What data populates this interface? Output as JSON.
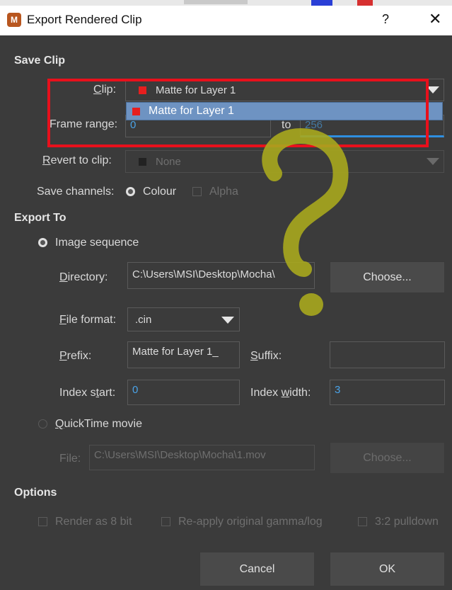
{
  "window": {
    "title": "Export Rendered Clip",
    "help": "?",
    "close": "✕",
    "app_icon": "M"
  },
  "save_clip": {
    "heading": "Save Clip",
    "clip_label": "Clip:",
    "clip_value": "Matte for Layer 1",
    "clip_option": "Matte for Layer 1",
    "frame_range_label": "Frame range:",
    "frame_from": "0",
    "frame_to_label": "to",
    "frame_to": "256",
    "revert_label": "Revert to clip:",
    "revert_value": "None",
    "channels_label": "Save channels:",
    "colour_label": "Colour",
    "alpha_label": "Alpha"
  },
  "export_to": {
    "heading": "Export To",
    "image_sequence_label": "Image sequence",
    "directory_label": "Directory:",
    "directory_value": "C:\\Users\\MSI\\Desktop\\Mocha\\",
    "choose_label": "Choose...",
    "file_format_label": "File format:",
    "file_format_value": ".cin",
    "prefix_label": "Prefix:",
    "prefix_value": "Matte for Layer 1_",
    "suffix_label": "Suffix:",
    "suffix_value": "",
    "index_start_label": "Index start:",
    "index_start_value": "0",
    "index_width_label": "Index width:",
    "index_width_value": "3",
    "quicktime_label": "QuickTime movie",
    "file_label": "File:",
    "file_value": "C:\\Users\\MSI\\Desktop\\Mocha\\1.mov",
    "file_choose_label": "Choose..."
  },
  "options": {
    "heading": "Options",
    "render8": "Render as 8 bit",
    "reapply": "Re-apply original gamma/log",
    "pulldown": "3:2 pulldown"
  },
  "footer": {
    "cancel": "Cancel",
    "ok": "OK"
  },
  "colors": {
    "annotation_red": "#e8101c",
    "annotation_marker": "#a8a81e",
    "selection_blue": "#6e93c2",
    "swatch_red": "#e61e1e"
  },
  "annotation": {
    "mark": "question-mark",
    "box": "red-highlight-rectangle"
  }
}
